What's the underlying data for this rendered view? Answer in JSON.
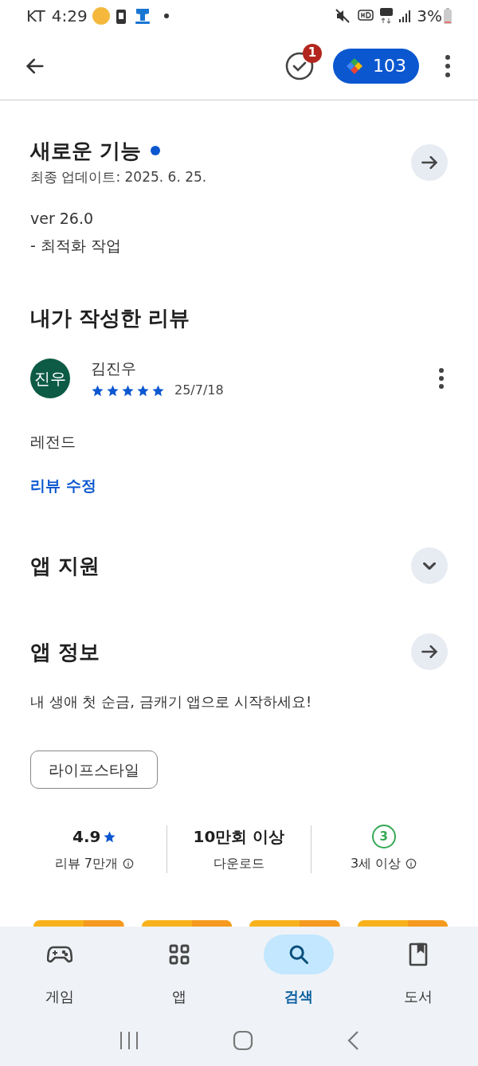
{
  "status_bar": {
    "carrier": "KT",
    "time": "4:29",
    "battery": "3%"
  },
  "top_bar": {
    "task_badge": "1",
    "points": "103"
  },
  "whats_new": {
    "title": "새로운 기능",
    "new_dot": true,
    "updated": "최종 업데이트: 2025. 6. 25.",
    "lines": [
      "ver 26.0",
      "- 최적화 작업"
    ]
  },
  "my_review": {
    "title": "내가 작성한 리뷰",
    "avatar": "진우",
    "author": "김진우",
    "stars": 5,
    "date": "25/7/18",
    "text": "레전드",
    "edit_link": "리뷰 수정"
  },
  "sections": [
    {
      "title": "앱 지원",
      "kind": "expand"
    },
    {
      "title": "앱 정보",
      "kind": "arrow"
    }
  ],
  "app_info": {
    "description": "내 생애 첫 순금, 금캐기 앱으로 시작하세요!",
    "category": "라이프스타일"
  },
  "stats": [
    {
      "kind": "rating",
      "value": "4.9",
      "label": "리뷰 7만개"
    },
    {
      "kind": "text",
      "value": "10만회 이상",
      "label": "다운로드"
    },
    {
      "kind": "age",
      "value": "3",
      "label": "3세 이상"
    }
  ],
  "bottom_nav": [
    {
      "label": "게임",
      "kind": "game",
      "selected": false
    },
    {
      "label": "앱",
      "kind": "apps",
      "selected": false
    },
    {
      "label": "검색",
      "kind": "search",
      "selected": true
    },
    {
      "label": "도서",
      "kind": "book",
      "selected": false
    }
  ]
}
